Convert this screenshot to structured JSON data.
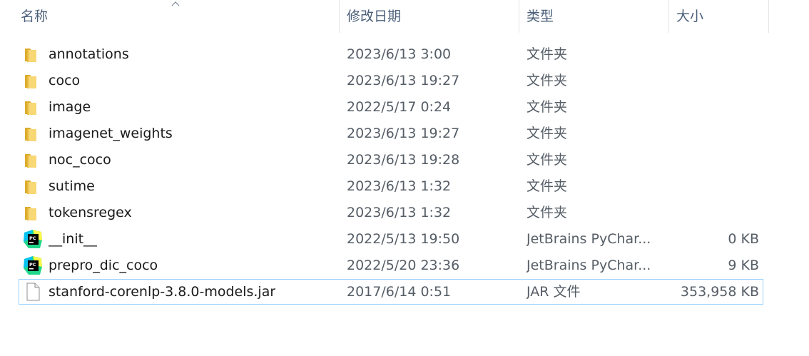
{
  "columns": {
    "name": "名称",
    "modified": "修改日期",
    "type": "类型",
    "size": "大小"
  },
  "sort": {
    "column": "name",
    "direction": "ascending"
  },
  "files": [
    {
      "name": "annotations",
      "modified": "2023/6/13 3:00",
      "type": "文件夹",
      "size": "",
      "icon": "folder-icon"
    },
    {
      "name": "coco",
      "modified": "2023/6/13 19:27",
      "type": "文件夹",
      "size": "",
      "icon": "folder-icon"
    },
    {
      "name": "image",
      "modified": "2022/5/17 0:24",
      "type": "文件夹",
      "size": "",
      "icon": "folder-icon"
    },
    {
      "name": "imagenet_weights",
      "modified": "2023/6/13 19:27",
      "type": "文件夹",
      "size": "",
      "icon": "folder-icon"
    },
    {
      "name": "noc_coco",
      "modified": "2023/6/13 19:28",
      "type": "文件夹",
      "size": "",
      "icon": "folder-icon"
    },
    {
      "name": "sutime",
      "modified": "2023/6/13 1:32",
      "type": "文件夹",
      "size": "",
      "icon": "folder-icon"
    },
    {
      "name": "tokensregex",
      "modified": "2023/6/13 1:32",
      "type": "文件夹",
      "size": "",
      "icon": "folder-icon"
    },
    {
      "name": "__init__",
      "modified": "2022/5/13 19:50",
      "type": "JetBrains PyChar...",
      "size": "0 KB",
      "icon": "pycharm-icon"
    },
    {
      "name": "prepro_dic_coco",
      "modified": "2022/5/20 23:36",
      "type": "JetBrains PyChar...",
      "size": "9 KB",
      "icon": "pycharm-icon"
    },
    {
      "name": "stanford-corenlp-3.8.0-models.jar",
      "modified": "2017/6/14 0:51",
      "type": "JAR 文件",
      "size": "353,958 KB",
      "icon": "file-icon"
    }
  ],
  "colors": {
    "header_text": "#4c607a",
    "focus_border": "#99d1ff",
    "folder_yellow": "#f8d775",
    "pycharm_green": "#21d789"
  }
}
